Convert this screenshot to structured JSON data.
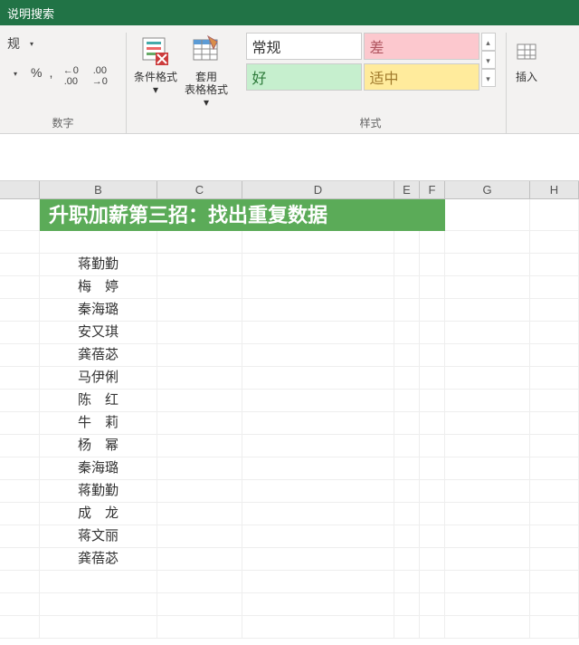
{
  "titlebar": {
    "search_placeholder": "说明搜索"
  },
  "ribbon": {
    "number_group": {
      "format_dropdown": "规",
      "percent": "%",
      "comma": ",",
      "dec_inc": ".0 .00",
      "dec_dec": ".00 .0",
      "label": "数字"
    },
    "cond_format": {
      "label": "条件格式",
      "arrow": "▾"
    },
    "table_format": {
      "label": "套用\n表格格式",
      "arrow": "▾"
    },
    "styles": {
      "normal": "常规",
      "bad": "差",
      "good": "好",
      "neutral": "适中",
      "label": "样式"
    },
    "insert": {
      "label": "插入"
    }
  },
  "columns": [
    "",
    "B",
    "C",
    "D",
    "E",
    "F",
    "G",
    "H"
  ],
  "banner": "升职加薪第三招：找出重复数据",
  "names": [
    "蒋勤勤",
    "梅　婷",
    "秦海璐",
    "安又琪",
    "龚蓓苾",
    "马伊俐",
    "陈　红",
    "牛　莉",
    "杨　幂",
    "秦海璐",
    "蒋勤勤",
    "成　龙",
    "蒋文丽",
    "龚蓓苾"
  ],
  "chart_data": {
    "type": "table",
    "title": "升职加薪第三招：找出重复数据",
    "columns": [
      "B"
    ],
    "rows": [
      [
        "蒋勤勤"
      ],
      [
        "梅 婷"
      ],
      [
        "秦海璐"
      ],
      [
        "安又琪"
      ],
      [
        "龚蓓苾"
      ],
      [
        "马伊俐"
      ],
      [
        "陈 红"
      ],
      [
        "牛 莉"
      ],
      [
        "杨 幂"
      ],
      [
        "秦海璐"
      ],
      [
        "蒋勤勤"
      ],
      [
        "成 龙"
      ],
      [
        "蒋文丽"
      ],
      [
        "龚蓓苾"
      ]
    ]
  }
}
